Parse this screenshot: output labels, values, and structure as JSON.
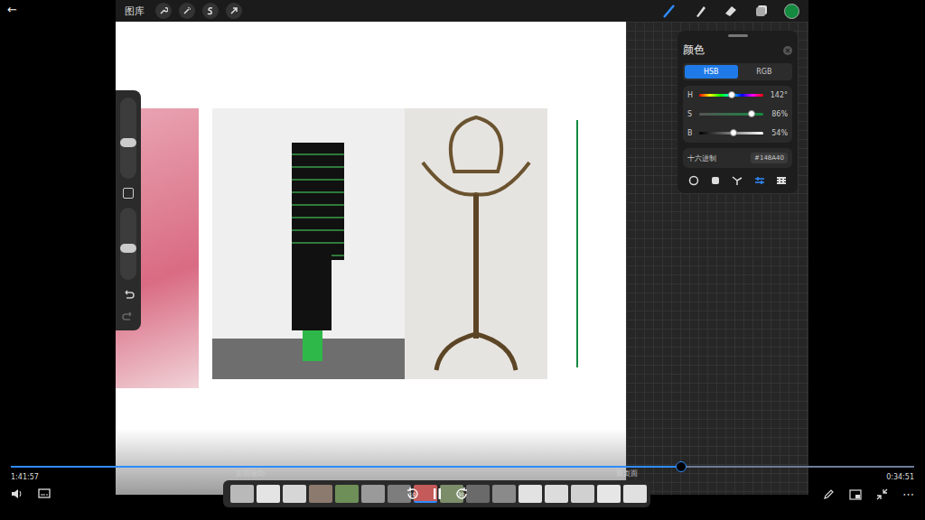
{
  "player": {
    "back": "←",
    "elapsed": "1:41:57",
    "remaining": "0:34:51",
    "progress": 0.742,
    "rewind": "10",
    "forward": "30",
    "more": "⋯"
  },
  "app": {
    "gallery": "图库"
  },
  "colorPanel": {
    "title": "颜色",
    "current": "#148A40",
    "tabs": [
      {
        "label": "HSB",
        "selected": true
      },
      {
        "label": "RGB",
        "selected": false
      }
    ],
    "sliders": [
      {
        "name": "H",
        "reading": "142°",
        "level": 0.5,
        "kind": "hue"
      },
      {
        "name": "S",
        "reading": "86%",
        "level": 0.81,
        "kind": "sat"
      },
      {
        "name": "B",
        "reading": "54%",
        "level": 0.54,
        "kind": "bright"
      }
    ],
    "hex": {
      "label": "十六进制",
      "value": "#148A40"
    },
    "modes": [
      {
        "kind": "disc",
        "selected": false
      },
      {
        "kind": "classic",
        "selected": false
      },
      {
        "kind": "harmony",
        "selected": false
      },
      {
        "kind": "value",
        "selected": true
      },
      {
        "kind": "palette",
        "selected": false
      }
    ]
  },
  "pages": {
    "helper": "页面辅助",
    "newPage": "新页面",
    "thumbs": [
      {
        "color": "#b9b9b9",
        "selected": false
      },
      {
        "color": "#e4e4e4",
        "selected": false
      },
      {
        "color": "#d6d6d6",
        "selected": false
      },
      {
        "color": "#8c7a6e",
        "selected": false
      },
      {
        "color": "#6f8f58",
        "selected": false
      },
      {
        "color": "#9a9a9a",
        "selected": false
      },
      {
        "color": "#7d7d7d",
        "selected": false
      },
      {
        "color": "#c55a5a",
        "selected": true
      },
      {
        "color": "#7c8d6a",
        "selected": false
      },
      {
        "color": "#6a6a6a",
        "selected": false
      },
      {
        "color": "#8a8a8a",
        "selected": false
      },
      {
        "color": "#e2e2e2",
        "selected": false
      },
      {
        "color": "#dcdcdc",
        "selected": false
      },
      {
        "color": "#d0d0d0",
        "selected": false
      },
      {
        "color": "#e6e6e6",
        "selected": false
      },
      {
        "color": "#e0e0e0",
        "selected": false
      }
    ]
  }
}
